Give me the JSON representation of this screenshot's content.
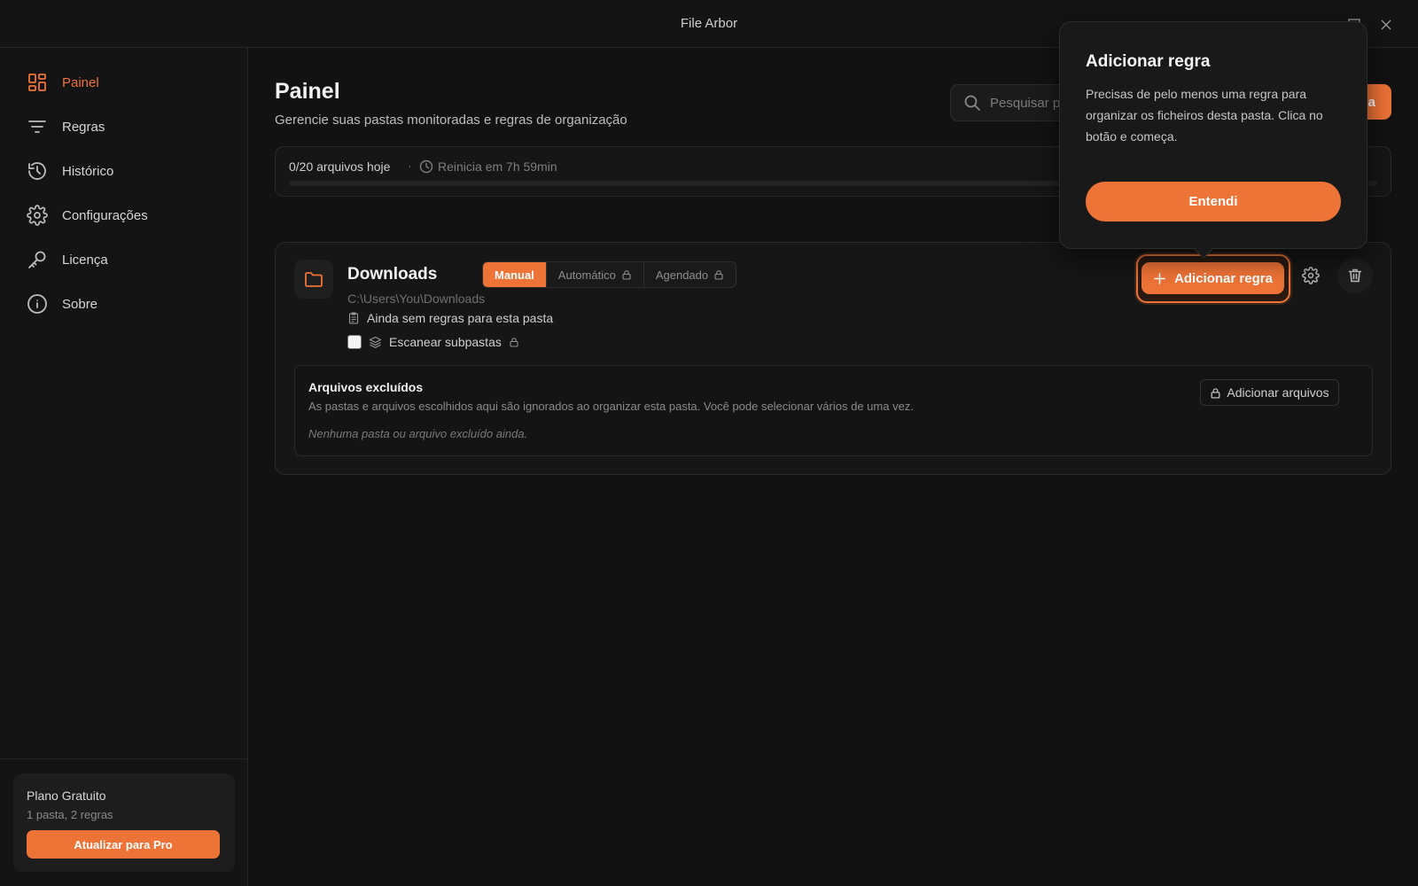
{
  "app": {
    "title": "File Arbor"
  },
  "colors": {
    "accent": "#ee7336",
    "background": "#121212"
  },
  "sidebar": {
    "items": [
      {
        "label": "Painel",
        "icon": "dashboard-icon",
        "active": true
      },
      {
        "label": "Regras",
        "icon": "filter-icon"
      },
      {
        "label": "Histórico",
        "icon": "history-icon"
      },
      {
        "label": "Configurações",
        "icon": "gear-icon"
      },
      {
        "label": "Licença",
        "icon": "key-icon"
      },
      {
        "label": "Sobre",
        "icon": "info-icon"
      }
    ],
    "plan": {
      "name": "Plano Gratuito",
      "limits": "1 pasta, 2 regras",
      "upgrade_label": "Atualizar para Pro"
    }
  },
  "header": {
    "title": "Painel",
    "subtitle": "Gerencie suas pastas monitoradas e regras de organização",
    "search_placeholder": "Pesquisar pa",
    "add_folder_partial": "a"
  },
  "usage": {
    "count": "0/20 arquivos hoje",
    "separator": "·",
    "reset": "Reinicia em 7h 59min",
    "progress": 0
  },
  "folder": {
    "name": "Downloads",
    "modes": [
      {
        "label": "Manual",
        "active": true,
        "locked": false
      },
      {
        "label": "Automático",
        "active": false,
        "locked": true
      },
      {
        "label": "Agendado",
        "active": false,
        "locked": true
      }
    ],
    "path": "C:\\Users\\You\\Downloads",
    "no_rules": "Ainda sem regras para esta pasta",
    "scan_subfolders": "Escanear subpastas",
    "add_rule_label": "Adicionar regra",
    "excluded": {
      "title": "Arquivos excluídos",
      "description": "As pastas e arquivos escolhidos aqui são ignorados ao organizar esta pasta. Você pode selecionar vários de uma vez.",
      "empty": "Nenhuma pasta ou arquivo excluído ainda.",
      "add_files_label": "Adicionar arquivos"
    }
  },
  "popover": {
    "title": "Adicionar regra",
    "body": "Precisas de pelo menos uma regra para organizar os ficheiros desta pasta. Clica no botão e começa.",
    "button": "Entendi"
  }
}
